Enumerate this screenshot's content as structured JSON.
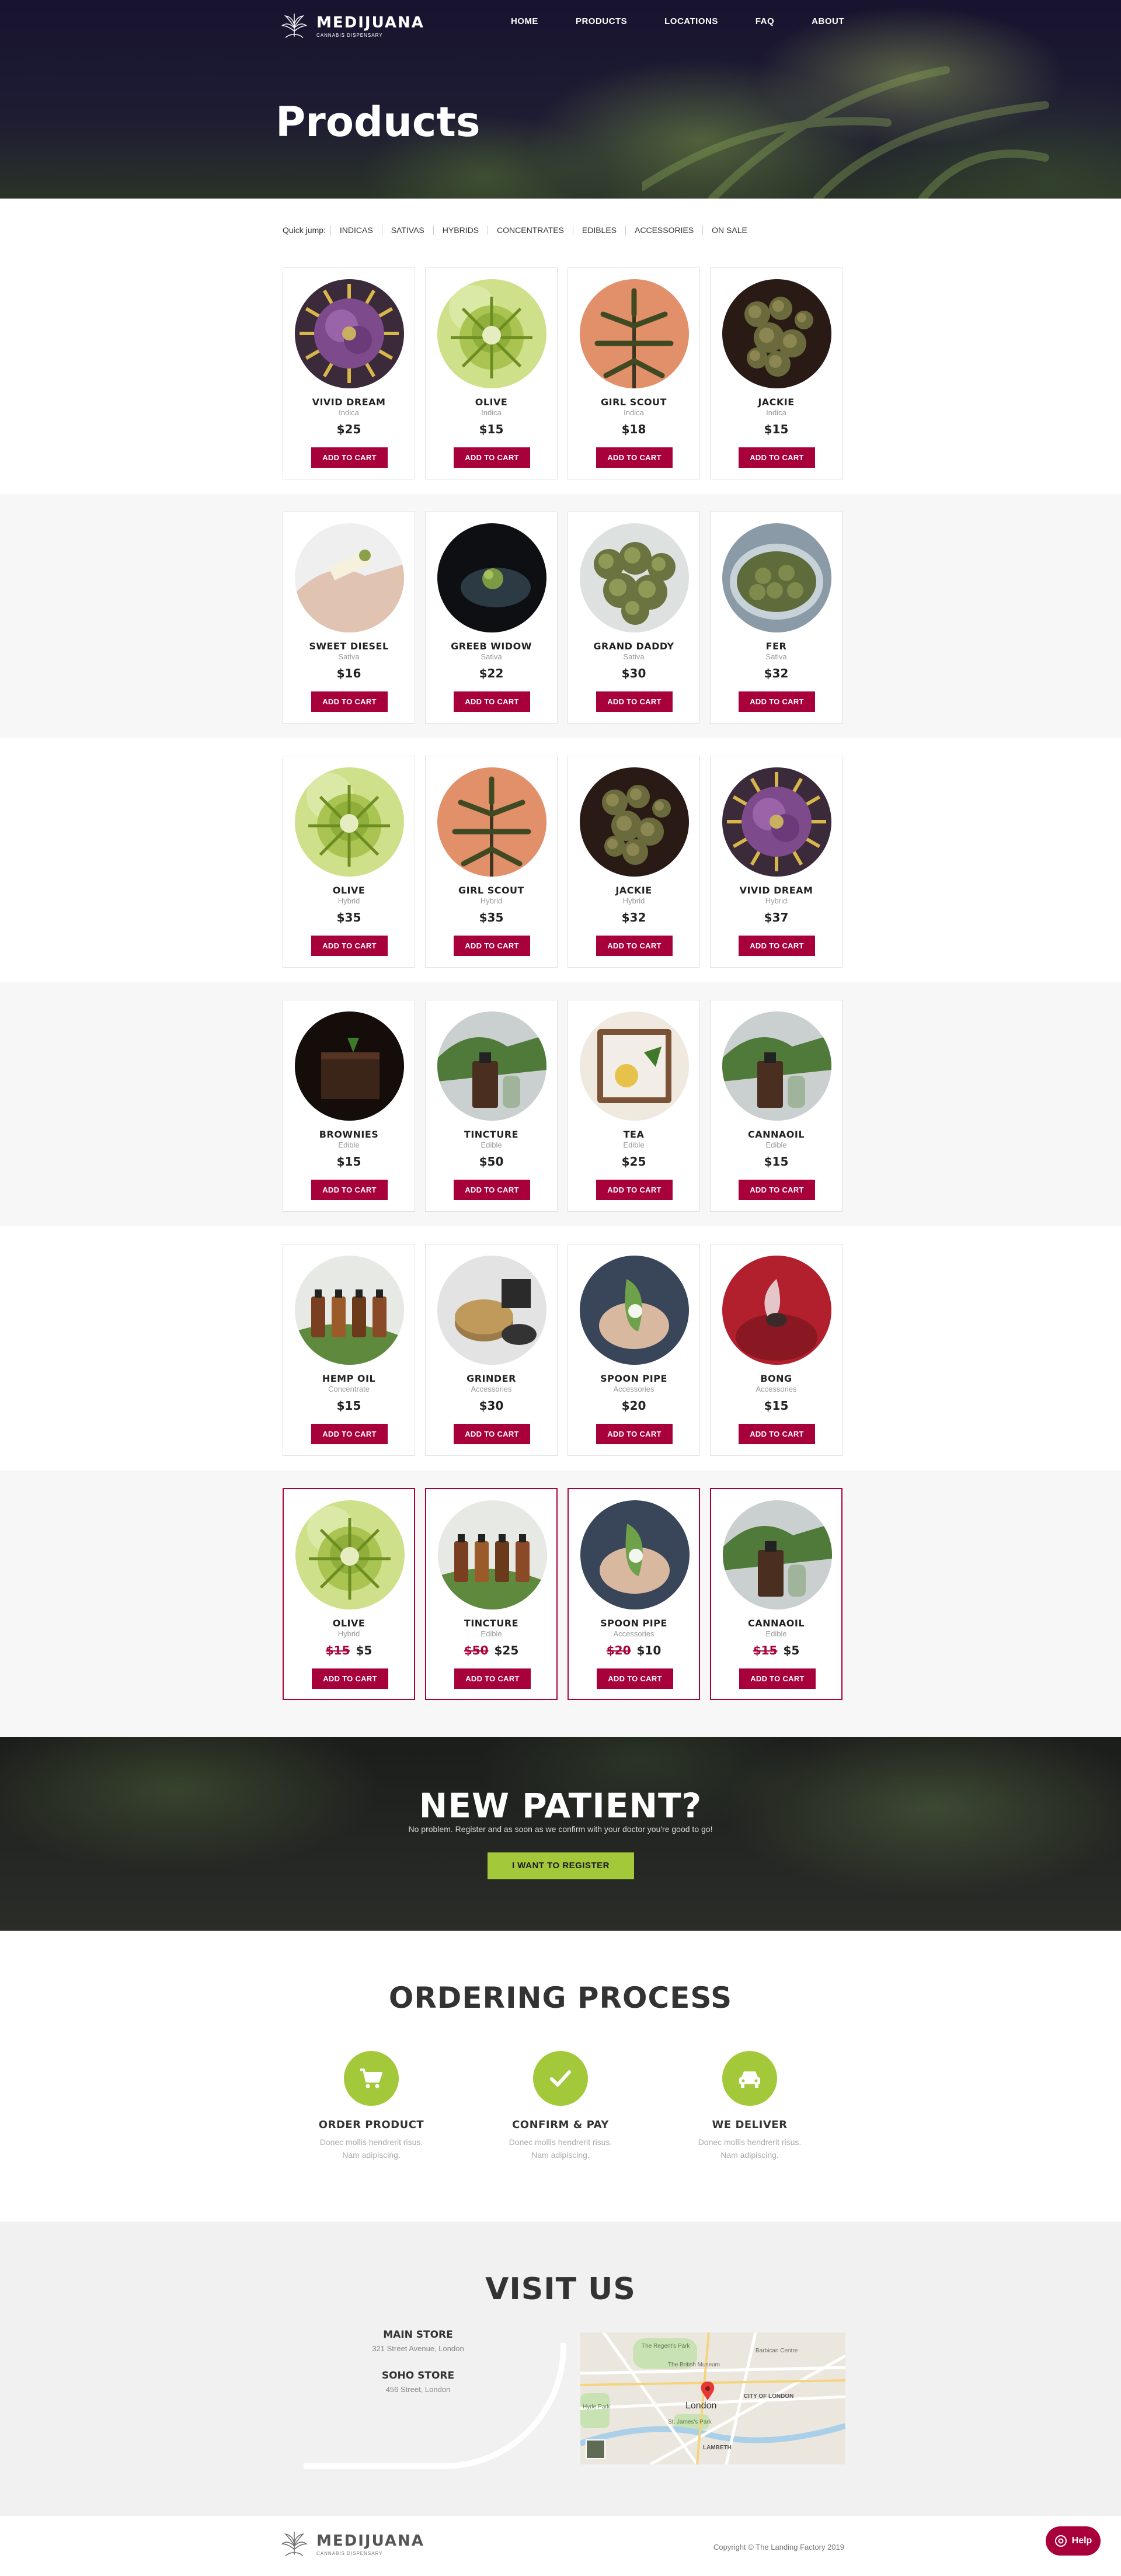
{
  "brand": {
    "name": "MEDIJUANA",
    "tagline": "CANNABIS DISPENSARY"
  },
  "nav": {
    "items": [
      "HOME",
      "PRODUCTS",
      "LOCATIONS",
      "FAQ",
      "ABOUT"
    ]
  },
  "hero": {
    "title": "Products"
  },
  "quick_jump": {
    "label": "Quick jump:",
    "links": [
      "INDICAS",
      "SATIVAS",
      "HYBRIDS",
      "CONCENTRATES",
      "EDIBLES",
      "ACCESSORIES",
      "ON SALE"
    ]
  },
  "product_sections": [
    {
      "products": [
        {
          "name": "VIVID DREAM",
          "category": "Indica",
          "price": "$25",
          "button": "ADD TO CART",
          "image": "purple-bud"
        },
        {
          "name": "OLIVE",
          "category": "Indica",
          "price": "$15",
          "button": "ADD TO CART",
          "image": "green-bud"
        },
        {
          "name": "GIRL SCOUT",
          "category": "Indica",
          "price": "$18",
          "button": "ADD TO CART",
          "image": "plant-orange"
        },
        {
          "name": "JACKIE",
          "category": "Indica",
          "price": "$15",
          "button": "ADD TO CART",
          "image": "dark-buds"
        }
      ]
    },
    {
      "products": [
        {
          "name": "SWEET DIESEL",
          "category": "Sativa",
          "price": "$16",
          "button": "ADD TO CART",
          "image": "joint-hands"
        },
        {
          "name": "GREEB WIDOW",
          "category": "Sativa",
          "price": "$22",
          "button": "ADD TO CART",
          "image": "hand-bud"
        },
        {
          "name": "GRAND DADDY",
          "category": "Sativa",
          "price": "$30",
          "button": "ADD TO CART",
          "image": "buds-pile"
        },
        {
          "name": "FER",
          "category": "Sativa",
          "price": "$32",
          "button": "ADD TO CART",
          "image": "jar-buds"
        }
      ]
    },
    {
      "products": [
        {
          "name": "OLIVE",
          "category": "Hybrid",
          "price": "$35",
          "button": "ADD TO CART",
          "image": "green-bud"
        },
        {
          "name": "GIRL SCOUT",
          "category": "Hybrid",
          "price": "$35",
          "button": "ADD TO CART",
          "image": "plant-orange"
        },
        {
          "name": "JACKIE",
          "category": "Hybrid",
          "price": "$32",
          "button": "ADD TO CART",
          "image": "dark-buds"
        },
        {
          "name": "VIVID DREAM",
          "category": "Hybrid",
          "price": "$37",
          "button": "ADD TO CART",
          "image": "purple-bud"
        }
      ]
    },
    {
      "products": [
        {
          "name": "BROWNIES",
          "category": "Edible",
          "price": "$15",
          "button": "ADD TO CART",
          "image": "brownie"
        },
        {
          "name": "TINCTURE",
          "category": "Edible",
          "price": "$50",
          "button": "ADD TO CART",
          "image": "tincture"
        },
        {
          "name": "TEA",
          "category": "Edible",
          "price": "$25",
          "button": "ADD TO CART",
          "image": "tea-tray"
        },
        {
          "name": "CANNAOIL",
          "category": "Edible",
          "price": "$15",
          "button": "ADD TO CART",
          "image": "tincture"
        }
      ]
    },
    {
      "products": [
        {
          "name": "HEMP OIL",
          "category": "Concentrate",
          "price": "$15",
          "button": "ADD TO CART",
          "image": "oil-bottles"
        },
        {
          "name": "GRINDER",
          "category": "Accessories",
          "price": "$30",
          "button": "ADD TO CART",
          "image": "grinder"
        },
        {
          "name": "SPOON PIPE",
          "category": "Accessories",
          "price": "$20",
          "button": "ADD TO CART",
          "image": "spoon-pipe"
        },
        {
          "name": "BONG",
          "category": "Accessories",
          "price": "$15",
          "button": "ADD TO CART",
          "image": "bong-red"
        }
      ]
    },
    {
      "products": [
        {
          "name": "OLIVE",
          "category": "Hybrid",
          "old_price": "$15",
          "price": "$5",
          "button": "ADD TO CART",
          "image": "green-bud",
          "sale": true
        },
        {
          "name": "TINCTURE",
          "category": "Edible",
          "old_price": "$50",
          "price": "$25",
          "button": "ADD TO CART",
          "image": "oil-bottles",
          "sale": true
        },
        {
          "name": "SPOON PIPE",
          "category": "Accessories",
          "old_price": "$20",
          "price": "$10",
          "button": "ADD TO CART",
          "image": "spoon-pipe",
          "sale": true
        },
        {
          "name": "CANNAOIL",
          "category": "Edible",
          "old_price": "$15",
          "price": "$5",
          "button": "ADD TO CART",
          "image": "tincture",
          "sale": true
        }
      ]
    }
  ],
  "new_patient": {
    "title": "NEW PATIENT?",
    "text": "No problem. Register and as soon as we confirm with your doctor you're good to go!",
    "button": "I WANT TO REGISTER"
  },
  "ordering": {
    "title": "ORDERING PROCESS",
    "steps": [
      {
        "title": "ORDER PRODUCT",
        "desc": "Donec mollis hendrerit risus. Nam adipiscing.",
        "icon": "cart-icon"
      },
      {
        "title": "CONFIRM & PAY",
        "desc": "Donec mollis hendrerit risus. Nam adipiscing.",
        "icon": "check-icon"
      },
      {
        "title": "WE DELIVER",
        "desc": "Donec mollis hendrerit risus. Nam adipiscing.",
        "icon": "car-icon"
      }
    ]
  },
  "visit": {
    "title": "VISIT US",
    "stores": [
      {
        "name": "MAIN STORE",
        "address": "321 Street Avenue, London"
      },
      {
        "name": "SOHO STORE",
        "address": "456 Street, London"
      }
    ],
    "map": {
      "labels": [
        "The Regent's Park",
        "The British Museum",
        "Barbican Centre",
        "Hyde Park",
        "CITY OF LONDON",
        "London",
        "St. James's Park",
        "LAMBETH"
      ],
      "marker": "map-pin-icon"
    }
  },
  "footer": {
    "copyright": "Copyright © The Landing Factory 2019"
  },
  "help": {
    "label": "Help"
  },
  "colors": {
    "accent": "#a8003b",
    "green": "#a3c93a",
    "hero_bg": "#15122c",
    "alt_section": "#f7f7f7"
  }
}
